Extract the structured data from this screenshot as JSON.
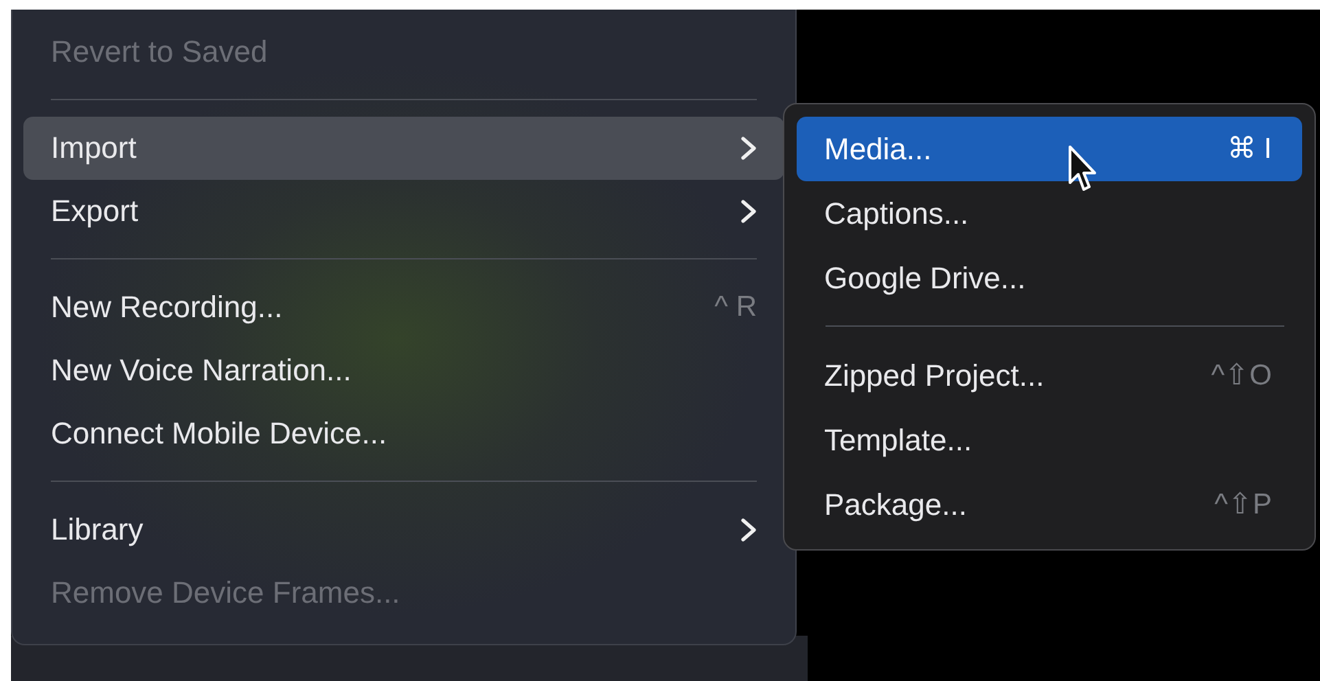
{
  "menu": {
    "items": [
      {
        "kind": "item",
        "label": "Revert to Saved",
        "disabled": true,
        "selected": false
      },
      {
        "kind": "separator"
      },
      {
        "kind": "item",
        "label": "Import",
        "disabled": false,
        "selected": true,
        "submenu": true
      },
      {
        "kind": "item",
        "label": "Export",
        "disabled": false,
        "selected": false,
        "submenu": true
      },
      {
        "kind": "separator"
      },
      {
        "kind": "item",
        "label": "New Recording...",
        "shortcut": "^ R",
        "disabled": false,
        "selected": false
      },
      {
        "kind": "item",
        "label": "New Voice Narration...",
        "disabled": false,
        "selected": false
      },
      {
        "kind": "item",
        "label": "Connect Mobile Device...",
        "disabled": false,
        "selected": false
      },
      {
        "kind": "separator"
      },
      {
        "kind": "item",
        "label": "Library",
        "disabled": false,
        "selected": false,
        "submenu": true
      },
      {
        "kind": "item",
        "label": "Remove Device Frames...",
        "disabled": true,
        "selected": false
      }
    ]
  },
  "submenu": {
    "items": [
      {
        "kind": "item",
        "label": "Media...",
        "shortcut": "⌘ I",
        "disabled": false,
        "selected": true
      },
      {
        "kind": "item",
        "label": "Captions...",
        "disabled": false,
        "selected": false
      },
      {
        "kind": "item",
        "label": "Google Drive...",
        "disabled": false,
        "selected": false
      },
      {
        "kind": "separator"
      },
      {
        "kind": "item",
        "label": "Zipped Project...",
        "shortcut": "^⇧O",
        "disabled": false,
        "selected": false
      },
      {
        "kind": "item",
        "label": "Template...",
        "disabled": false,
        "selected": false
      },
      {
        "kind": "item",
        "label": "Package...",
        "shortcut": "^⇧P",
        "disabled": false,
        "selected": false
      }
    ]
  }
}
